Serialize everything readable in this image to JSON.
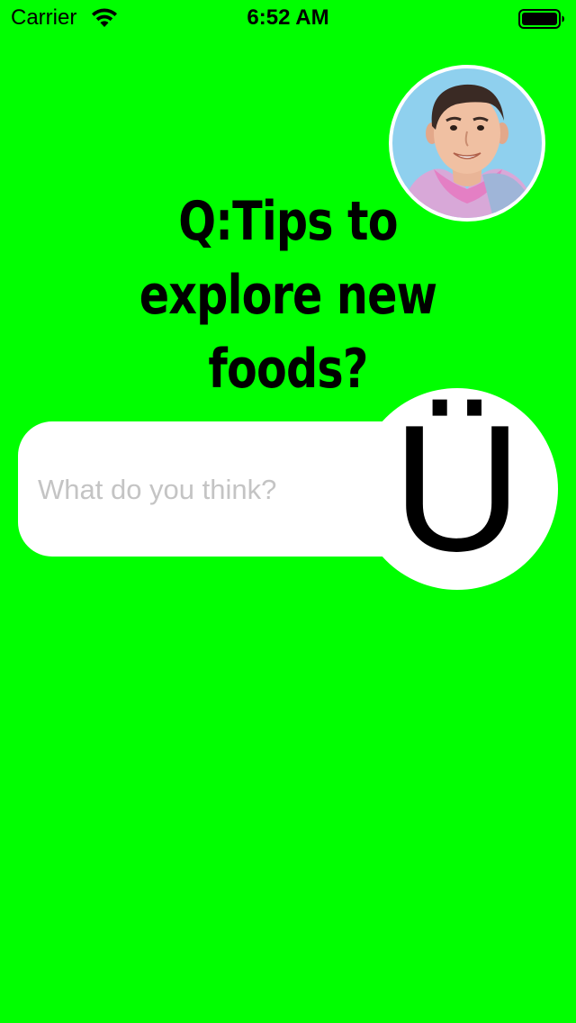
{
  "status_bar": {
    "carrier": "Carrier",
    "time": "6:52 AM",
    "icons": [
      "wifi-icon",
      "battery-icon"
    ]
  },
  "question": {
    "title": "Q:Tips to explore new foods?"
  },
  "answer": {
    "placeholder": "What do you think?",
    "submit_glyph": "Ü"
  },
  "colors": {
    "background": "#00ff00",
    "pill": "#ffffff",
    "placeholder": "#c4c4c4",
    "text": "#000000"
  }
}
